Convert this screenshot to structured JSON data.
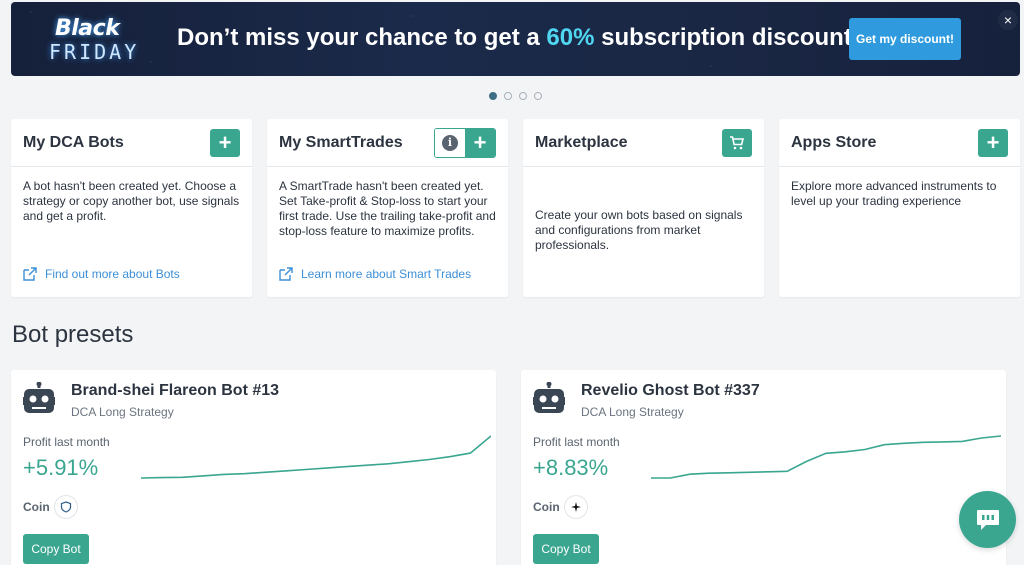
{
  "banner": {
    "logo_line1": "Black",
    "logo_line2": "FRIDAY",
    "text_before": "Don’t miss your chance to get a ",
    "text_highlight": "60%",
    "text_after": " subscription discount",
    "cta_label": "Get my discount!",
    "close_icon": "×"
  },
  "carousel": {
    "count": 4,
    "active": 0
  },
  "cards": [
    {
      "title": "My DCA Bots",
      "body": "A bot hasn't been created yet. Choose a strategy or copy another bot, use signals and get a profit.",
      "link": "Find out more about Bots",
      "action_icon": "plus-icon"
    },
    {
      "title": "My SmartTrades",
      "body": "A SmartTrade hasn't been created yet. Set Take-profit & Stop-loss to start your first trade. Use the trailing take-profit and stop-loss feature to maximize profits.",
      "link": "Learn more about Smart Trades",
      "action_icon": "plus-icon",
      "info_icon": "i"
    },
    {
      "title": "Marketplace",
      "body": "Create your own bots based on signals and configurations from market professionals.",
      "action_icon": "cart-icon"
    },
    {
      "title": "Apps Store",
      "body": "Explore more advanced instruments to level up your trading experience",
      "action_icon": "plus-icon"
    }
  ],
  "presets_title": "Bot presets",
  "presets": [
    {
      "name": "Brand-shei Flareon Bot #13",
      "strategy": "DCA Long Strategy",
      "profit_label": "Profit last month",
      "profit_value": "+5.91%",
      "coin_label": "Coin",
      "coin_icon": "shield-coin-icon",
      "copy_label": "Copy Bot",
      "sparkline": [
        0,
        0.05,
        0.1,
        0.3,
        0.5,
        0.6,
        0.8,
        1.0,
        1.2,
        1.4,
        1.6,
        1.8,
        2.0,
        2.3,
        2.6,
        3.0,
        3.5,
        5.91
      ]
    },
    {
      "name": "Revelio Ghost Bot #337",
      "strategy": "DCA Long Strategy",
      "profit_label": "Profit last month",
      "profit_value": "+8.83%",
      "coin_label": "Coin",
      "coin_icon": "spark-coin-icon",
      "copy_label": "Copy Bot",
      "sparkline": [
        0,
        0,
        0.8,
        1.0,
        1.1,
        1.2,
        1.3,
        1.4,
        3.5,
        5.2,
        5.5,
        6.0,
        7.0,
        7.3,
        7.5,
        7.6,
        7.7,
        8.4,
        8.83
      ]
    }
  ],
  "colors": {
    "accent": "#3aa690",
    "link": "#3d8fd6",
    "banner_cta": "#2f9bde",
    "highlight": "#4fd6f0"
  }
}
